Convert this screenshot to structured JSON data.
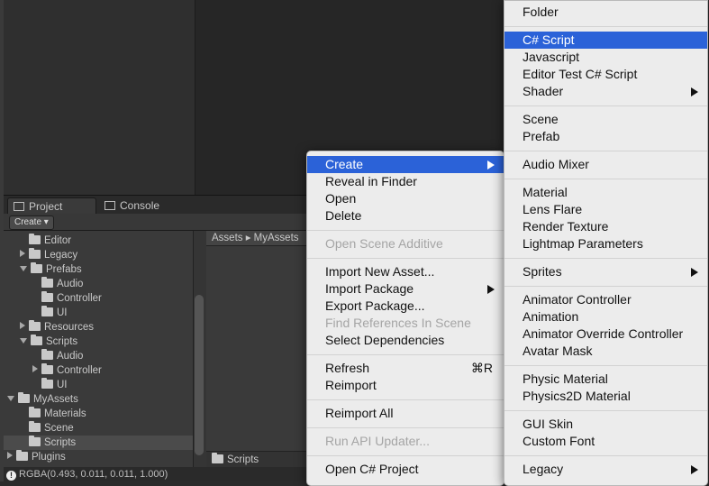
{
  "tabs": [
    {
      "label": "Project"
    },
    {
      "label": "Console"
    }
  ],
  "toolbar": {
    "create_label": "Create ▾"
  },
  "tree": [
    {
      "label": "Editor",
      "depth": 2,
      "arrow": "none"
    },
    {
      "label": "Legacy",
      "depth": 2,
      "arrow": "closed"
    },
    {
      "label": "Prefabs",
      "depth": 2,
      "arrow": "open"
    },
    {
      "label": "Audio",
      "depth": 3,
      "arrow": "none"
    },
    {
      "label": "Controller",
      "depth": 3,
      "arrow": "none"
    },
    {
      "label": "UI",
      "depth": 3,
      "arrow": "none"
    },
    {
      "label": "Resources",
      "depth": 2,
      "arrow": "closed"
    },
    {
      "label": "Scripts",
      "depth": 2,
      "arrow": "open"
    },
    {
      "label": "Audio",
      "depth": 3,
      "arrow": "none"
    },
    {
      "label": "Controller",
      "depth": 3,
      "arrow": "closed"
    },
    {
      "label": "UI",
      "depth": 3,
      "arrow": "none"
    },
    {
      "label": "MyAssets",
      "depth": 1,
      "arrow": "open"
    },
    {
      "label": "Materials",
      "depth": 2,
      "arrow": "none"
    },
    {
      "label": "Scene",
      "depth": 2,
      "arrow": "none"
    },
    {
      "label": "Scripts",
      "depth": 2,
      "arrow": "none",
      "selected": true
    },
    {
      "label": "Plugins",
      "depth": 1,
      "arrow": "closed"
    }
  ],
  "breadcrumb": {
    "text": "Assets ▸ MyAssets"
  },
  "assets_footer": {
    "label": "Scripts"
  },
  "status": {
    "text": "RGBA(0.493, 0.011, 0.011, 1.000)"
  },
  "context_menu": [
    {
      "label": "Create",
      "submenu": true,
      "highlighted": true
    },
    {
      "label": "Reveal in Finder"
    },
    {
      "label": "Open"
    },
    {
      "label": "Delete"
    },
    {
      "separator": true
    },
    {
      "label": "Open Scene Additive",
      "disabled": true
    },
    {
      "separator": true
    },
    {
      "label": "Import New Asset..."
    },
    {
      "label": "Import Package",
      "submenu": true
    },
    {
      "label": "Export Package..."
    },
    {
      "label": "Find References In Scene",
      "disabled": true
    },
    {
      "label": "Select Dependencies"
    },
    {
      "separator": true
    },
    {
      "label": "Refresh",
      "shortcut": "⌘R"
    },
    {
      "label": "Reimport"
    },
    {
      "separator": true
    },
    {
      "label": "Reimport All"
    },
    {
      "separator": true
    },
    {
      "label": "Run API Updater...",
      "disabled": true
    },
    {
      "separator": true
    },
    {
      "label": "Open C# Project"
    }
  ],
  "create_submenu": [
    {
      "label": "Folder"
    },
    {
      "separator": true
    },
    {
      "label": "C# Script",
      "highlighted": true
    },
    {
      "label": "Javascript"
    },
    {
      "label": "Editor Test C# Script"
    },
    {
      "label": "Shader",
      "submenu": true
    },
    {
      "separator": true
    },
    {
      "label": "Scene"
    },
    {
      "label": "Prefab"
    },
    {
      "separator": true
    },
    {
      "label": "Audio Mixer"
    },
    {
      "separator": true
    },
    {
      "label": "Material"
    },
    {
      "label": "Lens Flare"
    },
    {
      "label": "Render Texture"
    },
    {
      "label": "Lightmap Parameters"
    },
    {
      "separator": true
    },
    {
      "label": "Sprites",
      "submenu": true
    },
    {
      "separator": true
    },
    {
      "label": "Animator Controller"
    },
    {
      "label": "Animation"
    },
    {
      "label": "Animator Override Controller"
    },
    {
      "label": "Avatar Mask"
    },
    {
      "separator": true
    },
    {
      "label": "Physic Material"
    },
    {
      "label": "Physics2D Material"
    },
    {
      "separator": true
    },
    {
      "label": "GUI Skin"
    },
    {
      "label": "Custom Font"
    },
    {
      "separator": true
    },
    {
      "label": "Legacy",
      "submenu": true
    }
  ],
  "colors": {
    "highlight": "#2b62d8",
    "menu_bg": "#ececec",
    "panel_bg": "#3a3a3a"
  },
  "icons": [
    "folder-icon",
    "project-tab-icon",
    "console-tab-icon",
    "info-icon",
    "submenu-arrow-icon"
  ]
}
